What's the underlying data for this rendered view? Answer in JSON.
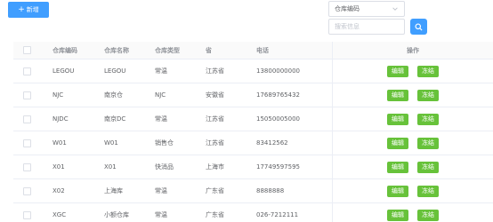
{
  "toolbar": {
    "add_label": "新增",
    "filter_select": "仓库编码",
    "search_placeholder": "搜索信息"
  },
  "colors": {
    "primary": "#409eff",
    "success": "#67c23a"
  },
  "table": {
    "headers": {
      "code": "仓库编码",
      "name": "仓库名称",
      "type": "仓库类型",
      "province": "省",
      "phone": "电话",
      "ops": "操作"
    },
    "edit_label": "编辑",
    "freeze_label": "冻结",
    "rows": [
      {
        "code": "LEGOU",
        "name": "LEGOU",
        "type": "常温",
        "province": "江苏省",
        "phone": "13800000000"
      },
      {
        "code": "NJC",
        "name": "南京仓",
        "type": "NJC",
        "province": "安徽省",
        "phone": "17689765432"
      },
      {
        "code": "NJDC",
        "name": "南京DC",
        "type": "常温",
        "province": "江苏省",
        "phone": "15050005000"
      },
      {
        "code": "W01",
        "name": "W01",
        "type": "销售仓",
        "province": "江苏省",
        "phone": "83412562"
      },
      {
        "code": "X01",
        "name": "X01",
        "type": "快消品",
        "province": "上海市",
        "phone": "17749597595"
      },
      {
        "code": "X02",
        "name": "上海库",
        "type": "常温",
        "province": "广东省",
        "phone": "8888888"
      },
      {
        "code": "XGC",
        "name": "小额仓库",
        "type": "常温",
        "province": "广东省",
        "phone": "026-7212111"
      }
    ]
  }
}
